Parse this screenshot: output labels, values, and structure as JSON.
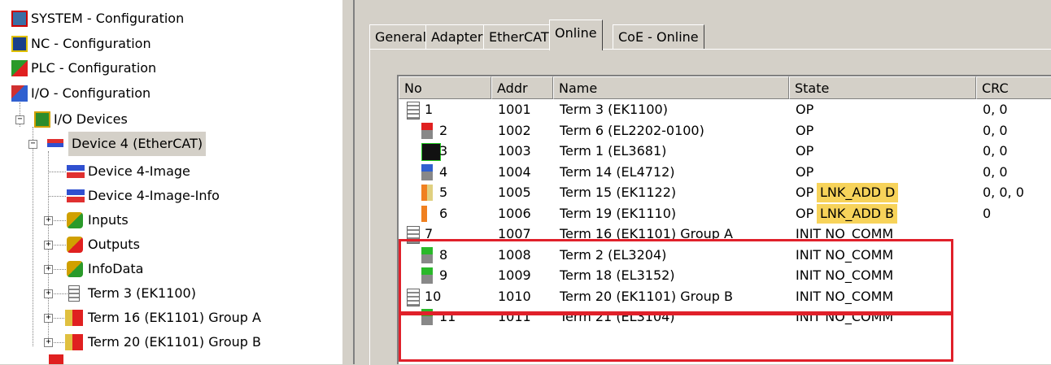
{
  "tree": {
    "items": [
      {
        "label": "SYSTEM - Configuration",
        "icon": "system-icon"
      },
      {
        "label": "NC - Configuration",
        "icon": "nc-icon"
      },
      {
        "label": "PLC - Configuration",
        "icon": "plc-icon"
      },
      {
        "label": "I/O - Configuration",
        "icon": "io-icon"
      },
      {
        "label": "I/O Devices",
        "icon": "io-devices-icon"
      },
      {
        "label": "Device 4 (EtherCAT)",
        "icon": "ethercat-device-icon"
      },
      {
        "label": "Device 4-Image",
        "icon": "image-icon"
      },
      {
        "label": "Device 4-Image-Info",
        "icon": "image-info-icon"
      },
      {
        "label": "Inputs",
        "icon": "inputs-icon"
      },
      {
        "label": "Outputs",
        "icon": "outputs-icon"
      },
      {
        "label": "InfoData",
        "icon": "infodata-icon"
      },
      {
        "label": "Term 3 (EK1100)",
        "icon": "coupler-icon"
      },
      {
        "label": "Term 16 (EK1101) Group A",
        "icon": "coupler-group-icon"
      },
      {
        "label": "Term 20 (EK1101) Group B",
        "icon": "coupler-group-icon"
      }
    ],
    "selected": "Device 4 (EtherCAT)"
  },
  "tabs": [
    {
      "label": "General"
    },
    {
      "label": "Adapter"
    },
    {
      "label": "EtherCAT"
    },
    {
      "label": "Online",
      "active": true
    },
    {
      "label": "CoE - Online"
    }
  ],
  "table": {
    "columns": [
      "No",
      "Addr",
      "Name",
      "State",
      "CRC"
    ],
    "rows": [
      {
        "no": "1",
        "addr": "1001",
        "name": "Term 3 (EK1100)",
        "state": "OP",
        "flag": "",
        "crc": "0, 0"
      },
      {
        "no": "2",
        "addr": "1002",
        "name": "Term 6 (EL2202-0100)",
        "state": "OP",
        "flag": "",
        "crc": "0, 0"
      },
      {
        "no": "3",
        "addr": "1003",
        "name": "Term 1 (EL3681)",
        "state": "OP",
        "flag": "",
        "crc": "0, 0"
      },
      {
        "no": "4",
        "addr": "1004",
        "name": "Term 14 (EL4712)",
        "state": "OP",
        "flag": "",
        "crc": "0, 0"
      },
      {
        "no": "5",
        "addr": "1005",
        "name": "Term 15 (EK1122)",
        "state": "OP",
        "flag": "LNK_ADD D",
        "crc": "0, 0, 0"
      },
      {
        "no": "6",
        "addr": "1006",
        "name": "Term 19 (EK1110)",
        "state": "OP",
        "flag": "LNK_ADD B",
        "crc": "0"
      },
      {
        "no": "7",
        "addr": "1007",
        "name": "Term 16 (EK1101) Group A",
        "state": "INIT NO_COMM",
        "flag": "",
        "crc": ""
      },
      {
        "no": "8",
        "addr": "1008",
        "name": "Term 2 (EL3204)",
        "state": "INIT NO_COMM",
        "flag": "",
        "crc": ""
      },
      {
        "no": "9",
        "addr": "1009",
        "name": "Term 18 (EL3152)",
        "state": "INIT NO_COMM",
        "flag": "",
        "crc": ""
      },
      {
        "no": "10",
        "addr": "1010",
        "name": "Term 20 (EK1101) Group B",
        "state": "INIT NO_COMM",
        "flag": "",
        "crc": ""
      },
      {
        "no": "11",
        "addr": "1011",
        "name": "Term 21 (EL3104)",
        "state": "INIT NO_COMM",
        "flag": "",
        "crc": ""
      }
    ]
  },
  "colors": {
    "highlight_box": "#e0202a",
    "link_flag": "#f7d35a"
  }
}
